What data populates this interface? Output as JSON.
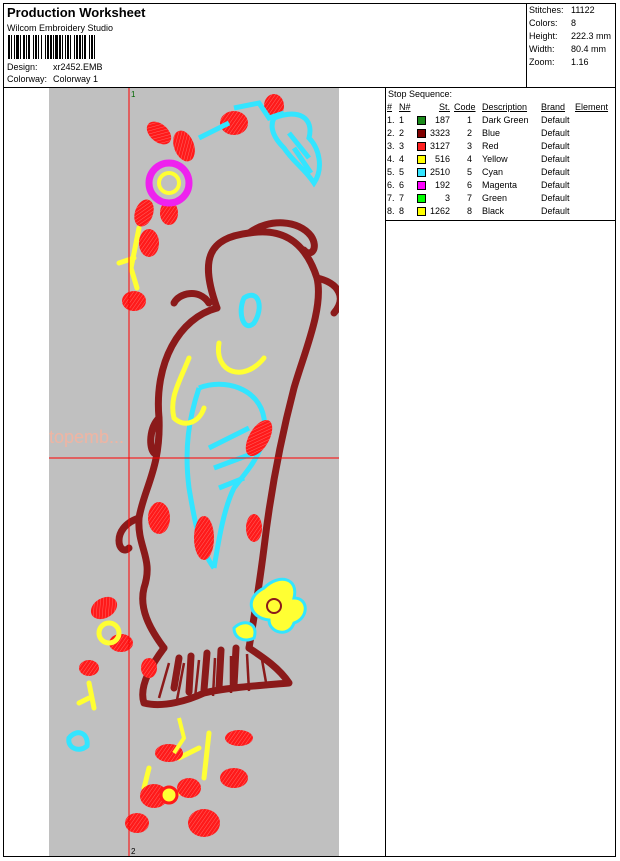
{
  "header": {
    "title": "Production Worksheet",
    "software": "Wilcom  Embroidery Studio",
    "design_label": "Design:",
    "design_value": "xr2452.EMB",
    "colorway_label": "Colorway:",
    "colorway_value": "Colorway  1"
  },
  "stats": [
    {
      "label": "Stitches:",
      "value": "11122"
    },
    {
      "label": "Colors:",
      "value": "8"
    },
    {
      "label": "Height:",
      "value": "222.3 mm"
    },
    {
      "label": "Width:",
      "value": "80.4 mm"
    },
    {
      "label": "Zoom:",
      "value": "1.16"
    }
  ],
  "design": {
    "watermark": "topemb...",
    "marker_top": "1",
    "marker_bottom": "2",
    "colors": {
      "canvas": "#c0c0c0",
      "dark_red": "#8b1a1a",
      "red": "#ff1a1a",
      "yellow": "#ffff33",
      "cyan": "#33e5ff",
      "magenta": "#ee22ee",
      "guide": "#ff0000"
    }
  },
  "stop_sequence": {
    "title": "Stop Sequence:",
    "headers": {
      "idx": "#",
      "n": "N#",
      "st": "St.",
      "code": "Code",
      "desc": "Description",
      "brand": "Brand",
      "element": "Element"
    },
    "rows": [
      {
        "idx": "1.",
        "n": "1",
        "color": "#1a8a1a",
        "st": "187",
        "code": "1",
        "desc": "Dark Green",
        "brand": "Default",
        "element": ""
      },
      {
        "idx": "2.",
        "n": "2",
        "color": "#800000",
        "st": "3323",
        "code": "2",
        "desc": "Blue",
        "brand": "Default",
        "element": ""
      },
      {
        "idx": "3.",
        "n": "3",
        "color": "#ff2020",
        "st": "3127",
        "code": "3",
        "desc": "Red",
        "brand": "Default",
        "element": ""
      },
      {
        "idx": "4.",
        "n": "4",
        "color": "#ffff00",
        "st": "516",
        "code": "4",
        "desc": "Yellow",
        "brand": "Default",
        "element": ""
      },
      {
        "idx": "5.",
        "n": "5",
        "color": "#33e5ff",
        "st": "2510",
        "code": "5",
        "desc": "Cyan",
        "brand": "Default",
        "element": ""
      },
      {
        "idx": "6.",
        "n": "6",
        "color": "#ff00ff",
        "st": "192",
        "code": "6",
        "desc": "Magenta",
        "brand": "Default",
        "element": ""
      },
      {
        "idx": "7.",
        "n": "7",
        "color": "#00ff00",
        "st": "3",
        "code": "7",
        "desc": "Green",
        "brand": "Default",
        "element": ""
      },
      {
        "idx": "8.",
        "n": "8",
        "color": "#ffff00",
        "st": "1262",
        "code": "8",
        "desc": "Black",
        "brand": "Default",
        "element": ""
      }
    ]
  }
}
